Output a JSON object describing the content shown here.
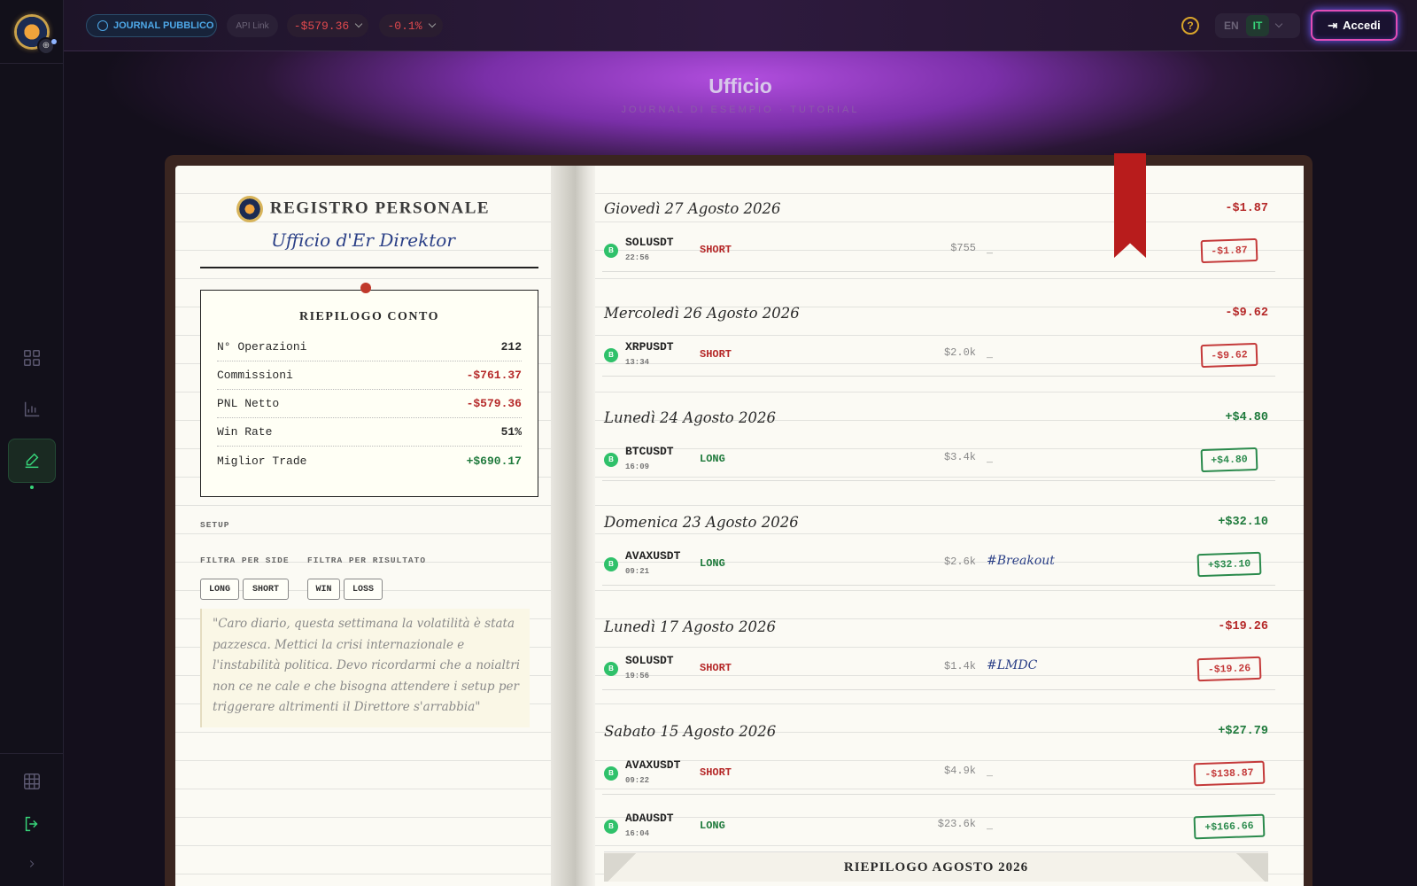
{
  "topbar": {
    "journal_label": "JOURNAL PUBBLICO",
    "api_label": "API Link",
    "pnl_value": "-$579.36",
    "pct_value": "-0.1%",
    "help_label": "?",
    "lang_en": "EN",
    "lang_it": "IT",
    "login_label": "Accedi"
  },
  "header": {
    "title": "Ufficio",
    "subtitle": "JOURNAL DI ESEMPIO · TUTORIAL"
  },
  "left_page": {
    "register_title": "REGISTRO PERSONALE",
    "office_name": "Ufficio d'Er Direktor",
    "summary": {
      "title": "RIEPILOGO CONTO",
      "rows": [
        {
          "label": "N° Operazioni",
          "value": "212"
        },
        {
          "label": "Commissioni",
          "value": "-$761.37"
        },
        {
          "label": "PNL Netto",
          "value": "-$579.36"
        },
        {
          "label": "Win Rate",
          "value": "51%"
        },
        {
          "label": "Miglior Trade",
          "value": "+$690.17"
        }
      ]
    },
    "setup_label": "SETUP",
    "filter_side_label": "FILTRA PER SIDE",
    "filter_result_label": "FILTRA PER RISULTATO",
    "filters": {
      "long": "LONG",
      "short": "SHORT",
      "win": "WIN",
      "loss": "LOSS"
    },
    "note": "\"Caro diario, questa settimana la volatilità è stata pazzesca. Mettici la crisi internazionale e l'instabilità politica. Devo ricordarmi che a noialtri non ce ne cale e che bisogna attendere i setup per triggerare altrimenti il Direttore s'arrabbia\""
  },
  "days": [
    {
      "date": "Giovedì 27 Agosto 2026",
      "total": "-$1.87"
    },
    {
      "date": "Mercoledì 26 Agosto 2026",
      "total": "-$9.62"
    },
    {
      "date": "Lunedì 24 Agosto 2026",
      "total": "+$4.80"
    },
    {
      "date": "Domenica 23 Agosto 2026",
      "total": "+$32.10"
    },
    {
      "date": "Lunedì 17 Agosto 2026",
      "total": "-$19.26"
    },
    {
      "date": "Sabato 15 Agosto 2026",
      "total": "+$27.79"
    }
  ],
  "trades": [
    {
      "badge": "B",
      "symbol": "SOLUSDT",
      "time": "22:56",
      "side": "SHORT",
      "size": "$755",
      "tag": "_",
      "pnl": "-$1.87"
    },
    {
      "badge": "B",
      "symbol": "XRPUSDT",
      "time": "13:34",
      "side": "SHORT",
      "size": "$2.0k",
      "tag": "_",
      "pnl": "-$9.62"
    },
    {
      "badge": "B",
      "symbol": "BTCUSDT",
      "time": "16:09",
      "side": "LONG",
      "size": "$3.4k",
      "tag": "_",
      "pnl": "+$4.80"
    },
    {
      "badge": "B",
      "symbol": "AVAXUSDT",
      "time": "09:21",
      "side": "LONG",
      "size": "$2.6k",
      "tag": "#Breakout",
      "pnl": "+$32.10"
    },
    {
      "badge": "B",
      "symbol": "SOLUSDT",
      "time": "19:56",
      "side": "SHORT",
      "size": "$1.4k",
      "tag": "#LMDC",
      "pnl": "-$19.26"
    },
    {
      "badge": "B",
      "symbol": "AVAXUSDT",
      "time": "09:22",
      "side": "SHORT",
      "size": "$4.9k",
      "tag": "_",
      "pnl": "-$138.87"
    },
    {
      "badge": "B",
      "symbol": "ADAUSDT",
      "time": "16:04",
      "side": "LONG",
      "size": "$23.6k",
      "tag": "_",
      "pnl": "+$166.66"
    }
  ],
  "month_summary": "RIEPILOGO AGOSTO 2026",
  "colors": {
    "loss": "#b52828",
    "profit": "#1f7a3c",
    "accent_green": "#37d67a",
    "ribbon": "#b81c1c"
  },
  "icons": [
    "dashboard-icon",
    "chart-icon",
    "pen-icon",
    "grid-icon",
    "logout-icon",
    "chevron-right-icon",
    "globe-icon",
    "help-icon",
    "login-icon"
  ]
}
